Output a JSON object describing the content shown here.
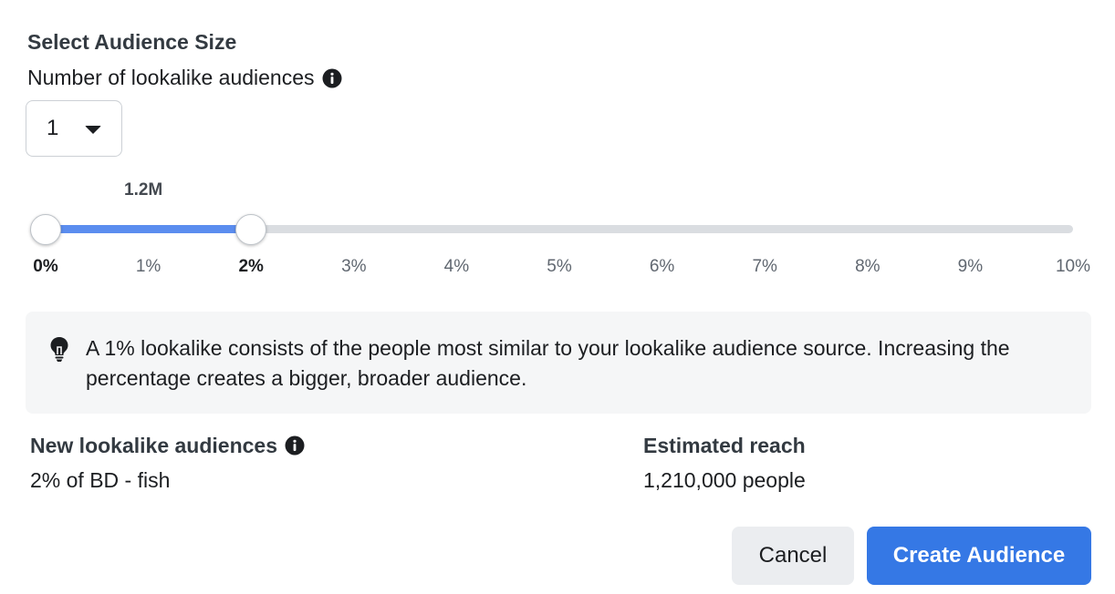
{
  "audience_size": {
    "title": "Select Audience Size",
    "number_label": "Number of lookalike audiences",
    "number_select": {
      "value": "1"
    }
  },
  "slider": {
    "value_label": "1.2M",
    "range_start_percent": 0,
    "range_end_percent": 2,
    "max_percent": 10,
    "ticks": [
      "0%",
      "1%",
      "2%",
      "3%",
      "4%",
      "5%",
      "6%",
      "7%",
      "8%",
      "9%",
      "10%"
    ],
    "accent_color": "#5b8def"
  },
  "tip": {
    "icon": "lightbulb-icon",
    "text": "A 1% lookalike consists of the people most similar to your lookalike audience source. Increasing the percentage creates a bigger, broader audience."
  },
  "summary": {
    "new_audiences_label": "New lookalike audiences",
    "new_audiences_value": "2% of BD - fish",
    "estimated_reach_label": "Estimated reach",
    "estimated_reach_value": "1,210,000 people"
  },
  "actions": {
    "cancel_label": "Cancel",
    "create_label": "Create Audience",
    "primary_color": "#3578e5"
  }
}
